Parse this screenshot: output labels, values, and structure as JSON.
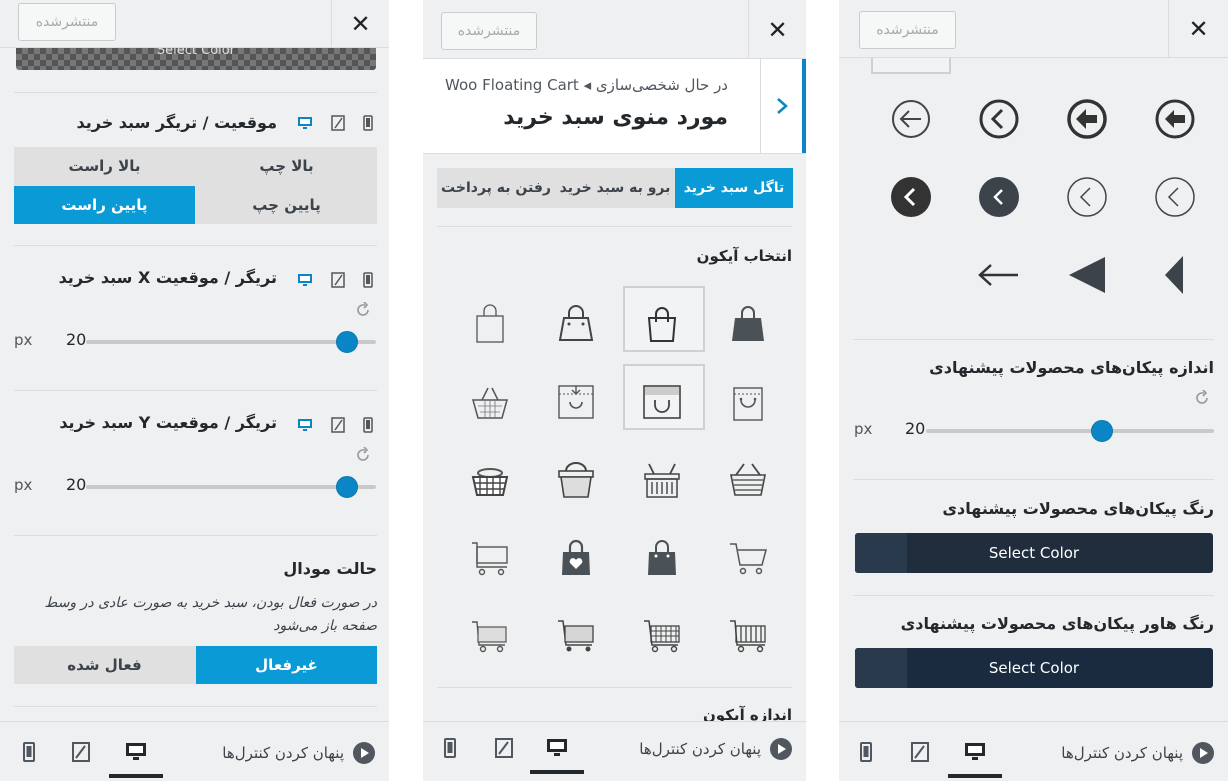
{
  "common": {
    "save_label": "منتشرشده",
    "close_label": "✕",
    "hide_controls_label": "پنهان کردن کنترل‌ها"
  },
  "panel1": {
    "top_color_text": "Select Color",
    "section_position": {
      "title": "موقعیت / تریگر سبد خرید",
      "options": [
        "بالا چپ",
        "بالا راست",
        "پایین چپ",
        "پایین راست"
      ],
      "selected": "پایین راست"
    },
    "section_x": {
      "title": "تریگر / موقعیت X سبد خرید",
      "unit": "px",
      "value": "20",
      "slider_fraction": 0.93
    },
    "section_y": {
      "title": "تریگر / موقعیت Y سبد خرید",
      "unit": "px",
      "value": "20",
      "slider_fraction": 0.93
    },
    "section_modal": {
      "title": "حالت مودال",
      "description": "در صورت فعال بودن، سبد خرید به صورت عادی در وسط صفحه باز می‌شود",
      "options": [
        "فعال شده",
        "غیرفعال"
      ],
      "selected": "غیرفعال"
    }
  },
  "panel2": {
    "breadcrumb_prefix": "در حال شخصی‌سازی",
    "breadcrumb_plugin": "Woo Floating Cart",
    "title": "مورد منوی سبد خرید",
    "tabs": [
      "تاگل سبد خرید",
      "برو به سبد خرید",
      "رفتن به پرداخت"
    ],
    "active_tab": "تاگل سبد خرید",
    "icon_section_title": "انتخاب آیکون",
    "next_section_partial": "اندازه آیکون",
    "icons": [
      "bag-filled-icon",
      "bag-outline-icon",
      "bag-handle-icon",
      "bag-plain-icon",
      "bag-tag-icon",
      "bag-dotted-icon",
      "bag-arrow-icon",
      "basket-outline-icon",
      "basket-wire-icon",
      "basket-striped-icon",
      "basket-dotted-icon",
      "basket-round-icon",
      "cart-outline-icon",
      "bag-dark-icon",
      "bag-heart-icon",
      "cart-flat-icon",
      "cart-striped-icon",
      "cart-grid-icon",
      "cart-dotted-icon",
      "cart-dotted-small-icon"
    ]
  },
  "panel3": {
    "arrows": [
      "arrow-circle-outline-icon",
      "chevron-circle-outline-icon",
      "arrow-circle-bold-icon",
      "arrow-circle-bold-2-icon",
      "chevron-circle-filled-icon",
      "chevron-circle-filled-2-icon",
      "chevron-circle-thin-icon",
      "chevron-circle-thin-2-icon",
      "arrow-line-icon",
      "triangle-large-icon",
      "triangle-small-icon"
    ],
    "size_section": {
      "title": "اندازه پیکان‌های محصولات پیشنهادی",
      "unit": "px",
      "value": "20",
      "slider_fraction": 0.61
    },
    "color_section": {
      "title": "رنگ پیکان‌های محصولات پیشنهادی",
      "button": "Select Color",
      "color": "#1f2d3d"
    },
    "hover_color_section": {
      "title": "رنگ هاور پیکان‌های محصولات پیشنهادی",
      "button": "Select Color",
      "color": "#1a2b40"
    }
  },
  "colors": {
    "accent": "#0a9bd6",
    "slider_knob": "#0a86c6"
  }
}
